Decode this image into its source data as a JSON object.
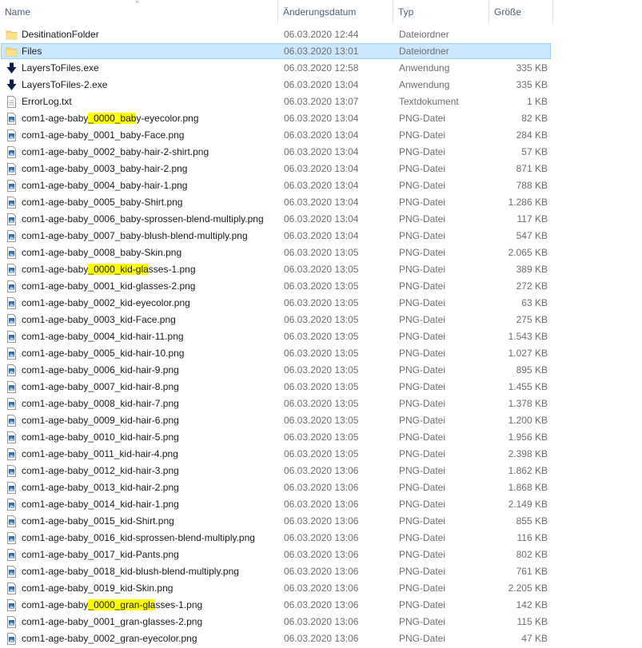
{
  "columns": {
    "name": "Name",
    "date": "Änderungsdatum",
    "type": "Typ",
    "size": "Größe"
  },
  "icons": {
    "folder": "folder-icon",
    "exe": "exe-arrow-icon",
    "txt": "text-file-icon",
    "png": "image-file-icon"
  },
  "colors": {
    "selection_bg": "#cce8ff",
    "selection_border": "#99d1ff",
    "highlight": "#ffff00",
    "folder": "#f8d775"
  },
  "files": [
    {
      "name": "DesitinationFolder",
      "date": "06.03.2020 12:44",
      "type": "Dateiordner",
      "size": "",
      "icon": "folder"
    },
    {
      "name": "Files",
      "date": "06.03.2020 13:01",
      "type": "Dateiordner",
      "size": "",
      "icon": "folder",
      "selected": true
    },
    {
      "name": "LayersToFiles.exe",
      "date": "06.03.2020 12:58",
      "type": "Anwendung",
      "size": "335 KB",
      "icon": "exe"
    },
    {
      "name": "LayersToFiles-2.exe",
      "date": "06.03.2020 13:04",
      "type": "Anwendung",
      "size": "335 KB",
      "icon": "exe"
    },
    {
      "name": "ErrorLog.txt",
      "date": "06.03.2020 13:07",
      "type": "Textdokument",
      "size": "1 KB",
      "icon": "txt"
    },
    {
      "name": "com1-age-baby_0000_baby-eyecolor.png",
      "pre": "com1-age-baby",
      "hl": "_0000_bab",
      "post": "y-eyecolor.png",
      "date": "06.03.2020 13:04",
      "type": "PNG-Datei",
      "size": "82 KB",
      "icon": "png"
    },
    {
      "name": "com1-age-baby_0001_baby-Face.png",
      "date": "06.03.2020 13:04",
      "type": "PNG-Datei",
      "size": "284 KB",
      "icon": "png"
    },
    {
      "name": "com1-age-baby_0002_baby-hair-2-shirt.png",
      "date": "06.03.2020 13:04",
      "type": "PNG-Datei",
      "size": "57 KB",
      "icon": "png"
    },
    {
      "name": "com1-age-baby_0003_baby-hair-2.png",
      "date": "06.03.2020 13:04",
      "type": "PNG-Datei",
      "size": "871 KB",
      "icon": "png"
    },
    {
      "name": "com1-age-baby_0004_baby-hair-1.png",
      "date": "06.03.2020 13:04",
      "type": "PNG-Datei",
      "size": "788 KB",
      "icon": "png"
    },
    {
      "name": "com1-age-baby_0005_baby-Shirt.png",
      "date": "06.03.2020 13:04",
      "type": "PNG-Datei",
      "size": "1.286 KB",
      "icon": "png"
    },
    {
      "name": "com1-age-baby_0006_baby-sprossen-blend-multiply.png",
      "date": "06.03.2020 13:04",
      "type": "PNG-Datei",
      "size": "117 KB",
      "icon": "png"
    },
    {
      "name": "com1-age-baby_0007_baby-blush-blend-multiply.png",
      "date": "06.03.2020 13:04",
      "type": "PNG-Datei",
      "size": "547 KB",
      "icon": "png"
    },
    {
      "name": "com1-age-baby_0008_baby-Skin.png",
      "date": "06.03.2020 13:05",
      "type": "PNG-Datei",
      "size": "2.065 KB",
      "icon": "png"
    },
    {
      "name": "com1-age-baby_0000_kid-glasses-1.png",
      "pre": "com1-age-baby",
      "hl": "_0000_kid-gla",
      "post": "sses-1.png",
      "date": "06.03.2020 13:05",
      "type": "PNG-Datei",
      "size": "389 KB",
      "icon": "png"
    },
    {
      "name": "com1-age-baby_0001_kid-glasses-2.png",
      "date": "06.03.2020 13:05",
      "type": "PNG-Datei",
      "size": "272 KB",
      "icon": "png"
    },
    {
      "name": "com1-age-baby_0002_kid-eyecolor.png",
      "date": "06.03.2020 13:05",
      "type": "PNG-Datei",
      "size": "63 KB",
      "icon": "png"
    },
    {
      "name": "com1-age-baby_0003_kid-Face.png",
      "date": "06.03.2020 13:05",
      "type": "PNG-Datei",
      "size": "275 KB",
      "icon": "png"
    },
    {
      "name": "com1-age-baby_0004_kid-hair-11.png",
      "date": "06.03.2020 13:05",
      "type": "PNG-Datei",
      "size": "1.543 KB",
      "icon": "png"
    },
    {
      "name": "com1-age-baby_0005_kid-hair-10.png",
      "date": "06.03.2020 13:05",
      "type": "PNG-Datei",
      "size": "1.027 KB",
      "icon": "png"
    },
    {
      "name": "com1-age-baby_0006_kid-hair-9.png",
      "date": "06.03.2020 13:05",
      "type": "PNG-Datei",
      "size": "895 KB",
      "icon": "png"
    },
    {
      "name": "com1-age-baby_0007_kid-hair-8.png",
      "date": "06.03.2020 13:05",
      "type": "PNG-Datei",
      "size": "1.455 KB",
      "icon": "png"
    },
    {
      "name": "com1-age-baby_0008_kid-hair-7.png",
      "date": "06.03.2020 13:05",
      "type": "PNG-Datei",
      "size": "1.378 KB",
      "icon": "png"
    },
    {
      "name": "com1-age-baby_0009_kid-hair-6.png",
      "date": "06.03.2020 13:05",
      "type": "PNG-Datei",
      "size": "1.200 KB",
      "icon": "png"
    },
    {
      "name": "com1-age-baby_0010_kid-hair-5.png",
      "date": "06.03.2020 13:05",
      "type": "PNG-Datei",
      "size": "1.956 KB",
      "icon": "png"
    },
    {
      "name": "com1-age-baby_0011_kid-hair-4.png",
      "date": "06.03.2020 13:05",
      "type": "PNG-Datei",
      "size": "2.398 KB",
      "icon": "png"
    },
    {
      "name": "com1-age-baby_0012_kid-hair-3.png",
      "date": "06.03.2020 13:06",
      "type": "PNG-Datei",
      "size": "1.862 KB",
      "icon": "png"
    },
    {
      "name": "com1-age-baby_0013_kid-hair-2.png",
      "date": "06.03.2020 13:06",
      "type": "PNG-Datei",
      "size": "1.868 KB",
      "icon": "png"
    },
    {
      "name": "com1-age-baby_0014_kid-hair-1.png",
      "date": "06.03.2020 13:06",
      "type": "PNG-Datei",
      "size": "2.149 KB",
      "icon": "png"
    },
    {
      "name": "com1-age-baby_0015_kid-Shirt.png",
      "date": "06.03.2020 13:06",
      "type": "PNG-Datei",
      "size": "855 KB",
      "icon": "png"
    },
    {
      "name": "com1-age-baby_0016_kid-sprossen-blend-multiply.png",
      "date": "06.03.2020 13:06",
      "type": "PNG-Datei",
      "size": "116 KB",
      "icon": "png"
    },
    {
      "name": "com1-age-baby_0017_kid-Pants.png",
      "date": "06.03.2020 13:06",
      "type": "PNG-Datei",
      "size": "802 KB",
      "icon": "png"
    },
    {
      "name": "com1-age-baby_0018_kid-blush-blend-multiply.png",
      "date": "06.03.2020 13:06",
      "type": "PNG-Datei",
      "size": "761 KB",
      "icon": "png"
    },
    {
      "name": "com1-age-baby_0019_kid-Skin.png",
      "date": "06.03.2020 13:06",
      "type": "PNG-Datei",
      "size": "2.205 KB",
      "icon": "png"
    },
    {
      "name": "com1-age-baby_0000_gran-glasses-1.png",
      "pre": "com1-age-baby",
      "hl": "_0000_gran-gla",
      "post": "sses-1.png",
      "date": "06.03.2020 13:06",
      "type": "PNG-Datei",
      "size": "142 KB",
      "icon": "png"
    },
    {
      "name": "com1-age-baby_0001_gran-glasses-2.png",
      "date": "06.03.2020 13:06",
      "type": "PNG-Datei",
      "size": "115 KB",
      "icon": "png"
    },
    {
      "name": "com1-age-baby_0002_gran-eyecolor.png",
      "date": "06.03.2020 13:06",
      "type": "PNG-Datei",
      "size": "47 KB",
      "icon": "png"
    }
  ]
}
